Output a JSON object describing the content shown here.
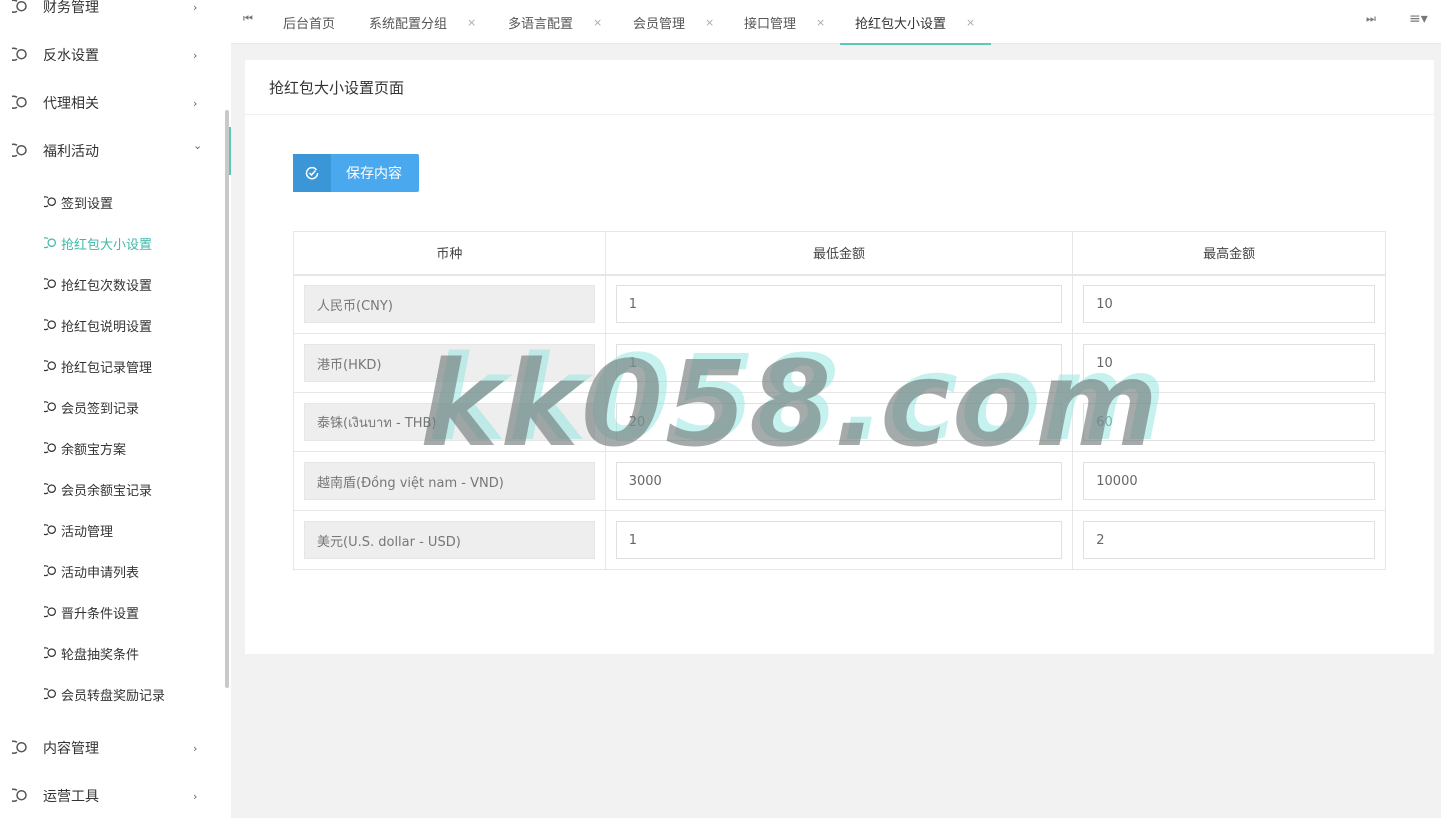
{
  "sidebar": {
    "menus": [
      {
        "label": "财务管理",
        "icon": "circle-icon"
      },
      {
        "label": "反水设置",
        "icon": "circle-icon"
      },
      {
        "label": "代理相关",
        "icon": "circle-icon"
      },
      {
        "label": "福利活动",
        "icon": "circle-icon",
        "open": true
      },
      {
        "label": "内容管理",
        "icon": "circle-icon"
      },
      {
        "label": "运营工具",
        "icon": "circle-icon"
      }
    ],
    "sub_items": [
      {
        "label": "签到设置"
      },
      {
        "label": "抢红包大小设置",
        "active": true
      },
      {
        "label": "抢红包次数设置"
      },
      {
        "label": "抢红包说明设置"
      },
      {
        "label": "抢红包记录管理"
      },
      {
        "label": "会员签到记录"
      },
      {
        "label": "余额宝方案"
      },
      {
        "label": "会员余额宝记录"
      },
      {
        "label": "活动管理"
      },
      {
        "label": "活动申请列表"
      },
      {
        "label": "晋升条件设置"
      },
      {
        "label": "轮盘抽奖条件"
      },
      {
        "label": "会员转盘奖励记录"
      }
    ],
    "arrow_right": "›",
    "arrow_down": "⌄",
    "accent_color": "#3fb8a9"
  },
  "tabs": {
    "nav_left": "⏮",
    "nav_right": "⏭",
    "menu_icon": "≡▾",
    "close_glyph": "×",
    "items": [
      {
        "label": "后台首页"
      },
      {
        "label": "系统配置分组"
      },
      {
        "label": "多语言配置"
      },
      {
        "label": "会员管理"
      },
      {
        "label": "接口管理"
      },
      {
        "label": "抢红包大小设置",
        "active": true
      }
    ]
  },
  "card": {
    "title": "抢红包大小设置页面",
    "save_label": "保存内容",
    "save_color": "#4aa9ee"
  },
  "table": {
    "headers": [
      "币种",
      "最低金额",
      "最高金额"
    ],
    "rows": [
      {
        "currency": "人民币(CNY)",
        "min": "1",
        "max": "10"
      },
      {
        "currency": "港币(HKD)",
        "min": "1",
        "max": "10"
      },
      {
        "currency": "泰铢(เงินบาท - THB)",
        "min": "20",
        "max": "60"
      },
      {
        "currency": "越南盾(Đồng việt nam - VND)",
        "min": "3000",
        "max": "10000"
      },
      {
        "currency": "美元(U.S. dollar - USD)",
        "min": "1",
        "max": "2"
      }
    ]
  },
  "watermark": "kk058.com"
}
